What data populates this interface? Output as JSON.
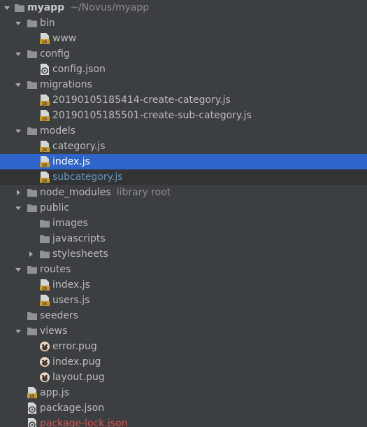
{
  "colors": {
    "background": "#3c3f41",
    "selection": "#2f65ca",
    "hover_row": "#313335",
    "text": "#bbbbbb",
    "hint_text": "#8c8c8c",
    "modified_file": "#6897bb",
    "error_file": "#d9534f",
    "folder": "#8e9294",
    "js_badge": "#c99a2e"
  },
  "tree": {
    "root": {
      "label": "myapp",
      "path": "~/Novus/myapp"
    },
    "nodes": [
      {
        "id": "bin",
        "label": "bin",
        "type": "folder",
        "expanded": true
      },
      {
        "id": "www",
        "label": "www",
        "type": "js"
      },
      {
        "id": "config",
        "label": "config",
        "type": "folder",
        "expanded": true
      },
      {
        "id": "config-json",
        "label": "config.json",
        "type": "json"
      },
      {
        "id": "migrations",
        "label": "migrations",
        "type": "folder",
        "expanded": true
      },
      {
        "id": "mig1",
        "label": "20190105185414-create-category.js",
        "type": "js"
      },
      {
        "id": "mig2",
        "label": "20190105185501-create-sub-category.js",
        "type": "js"
      },
      {
        "id": "models",
        "label": "models",
        "type": "folder",
        "expanded": true
      },
      {
        "id": "category",
        "label": "category.js",
        "type": "js"
      },
      {
        "id": "models-index",
        "label": "index.js",
        "type": "js",
        "selected": true
      },
      {
        "id": "subcategory",
        "label": "subcategory.js",
        "type": "js",
        "status": "modified"
      },
      {
        "id": "node-modules",
        "label": "node_modules",
        "hint": "library root",
        "type": "folder",
        "expanded": false
      },
      {
        "id": "public",
        "label": "public",
        "type": "folder",
        "expanded": true
      },
      {
        "id": "images",
        "label": "images",
        "type": "folder"
      },
      {
        "id": "javascripts",
        "label": "javascripts",
        "type": "folder"
      },
      {
        "id": "stylesheets",
        "label": "stylesheets",
        "type": "folder",
        "expanded": false
      },
      {
        "id": "routes",
        "label": "routes",
        "type": "folder",
        "expanded": true
      },
      {
        "id": "routes-index",
        "label": "index.js",
        "type": "js"
      },
      {
        "id": "users",
        "label": "users.js",
        "type": "js"
      },
      {
        "id": "seeders",
        "label": "seeders",
        "type": "folder"
      },
      {
        "id": "views",
        "label": "views",
        "type": "folder",
        "expanded": true
      },
      {
        "id": "error-pug",
        "label": "error.pug",
        "type": "pug"
      },
      {
        "id": "index-pug",
        "label": "index.pug",
        "type": "pug"
      },
      {
        "id": "layout-pug",
        "label": "layout.pug",
        "type": "pug"
      },
      {
        "id": "app-js",
        "label": "app.js",
        "type": "js"
      },
      {
        "id": "package-json",
        "label": "package.json",
        "type": "json"
      },
      {
        "id": "package-lock",
        "label": "package-lock.json",
        "type": "json",
        "status": "error"
      }
    ]
  }
}
